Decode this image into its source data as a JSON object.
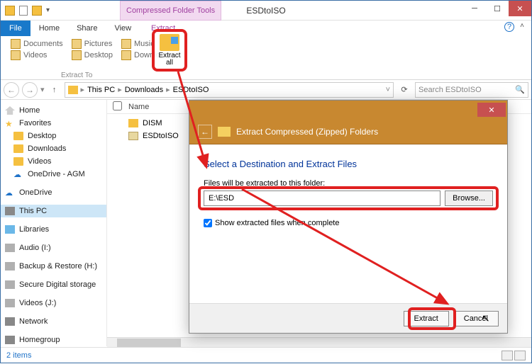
{
  "window": {
    "title": "ESDtoISO",
    "ribbon_tab": "Compressed Folder Tools"
  },
  "tabs": {
    "file": "File",
    "home": "Home",
    "share": "Share",
    "view": "View",
    "extract": "Extract"
  },
  "ribbon": {
    "items": [
      "Documents",
      "Pictures",
      "Music",
      "Videos",
      "Desktop",
      "Downloads"
    ],
    "group": "Extract To",
    "extract_all": "Extract all"
  },
  "address": {
    "pc": "This PC",
    "p1": "Downloads",
    "p2": "ESDtoISO"
  },
  "search": {
    "placeholder": "Search ESDtoISO"
  },
  "columns": {
    "name": "Name"
  },
  "files": [
    {
      "name": "DISM",
      "type": "folder"
    },
    {
      "name": "ESDtoISO",
      "type": "cab"
    }
  ],
  "sidebar": {
    "home": "Home",
    "favorites": "Favorites",
    "fav": [
      "Desktop",
      "Downloads",
      "Videos",
      "OneDrive - AGM"
    ],
    "onedrive": "OneDrive",
    "thispc": "This PC",
    "libraries": "Libraries",
    "drives": [
      "Audio (I:)",
      "Backup & Restore (H:)",
      "Secure Digital storage",
      "Videos (J:)"
    ],
    "network": "Network",
    "homegroup": "Homegroup"
  },
  "status": {
    "items": "2 items"
  },
  "dialog": {
    "banner": "Extract Compressed (Zipped) Folders",
    "heading": "Select a Destination and Extract Files",
    "label": "Files will be extracted to this folder:",
    "path": "E:\\ESD",
    "browse": "Browse...",
    "checkbox": "Show extracted files when complete",
    "extract": "Extract",
    "cancel": "Cancel"
  }
}
